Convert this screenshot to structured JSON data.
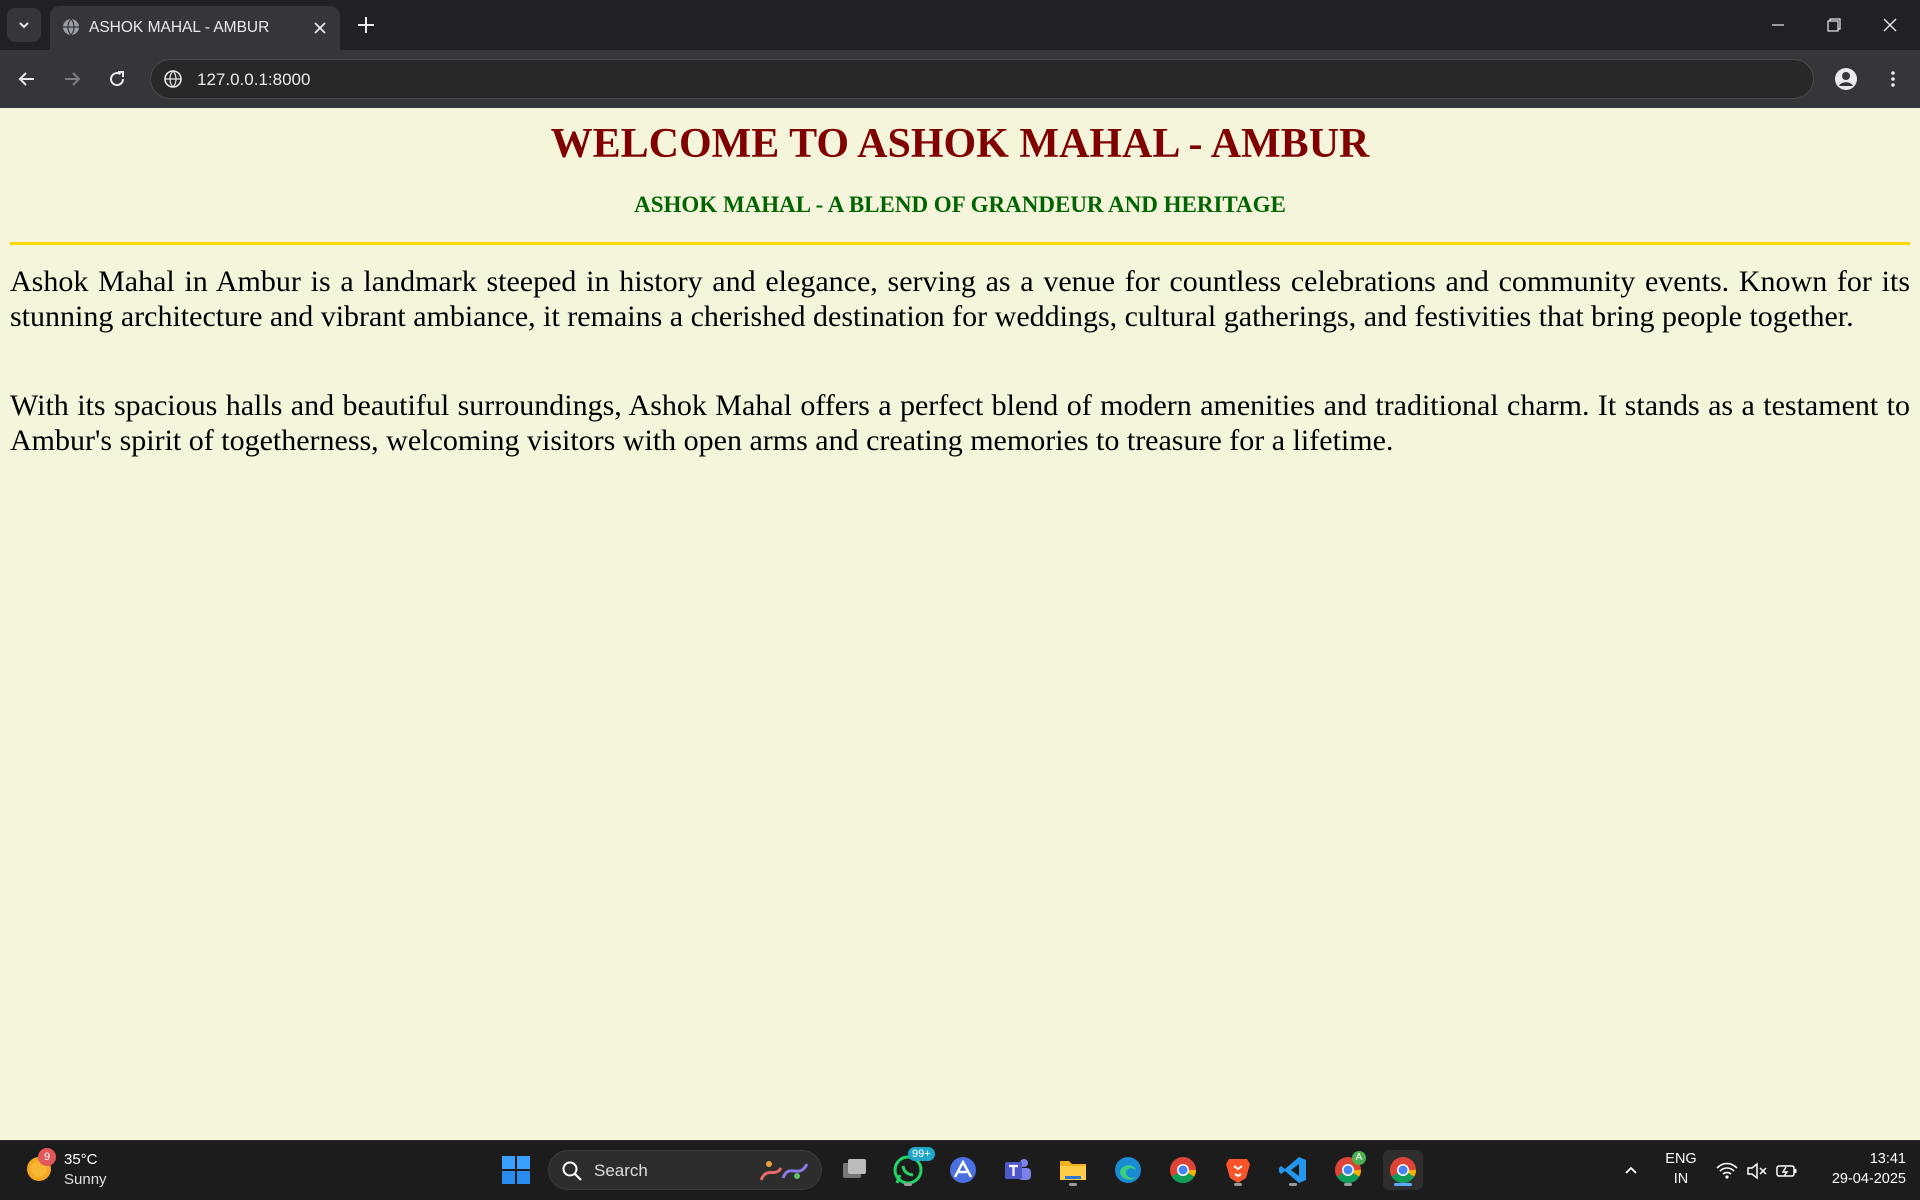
{
  "browser": {
    "tab_title": "ASHOK MAHAL - AMBUR",
    "url": "127.0.0.1:8000"
  },
  "page": {
    "heading": "WELCOME TO ASHOK MAHAL - AMBUR",
    "subheading": "ASHOK MAHAL - A BLEND OF GRANDEUR AND HERITAGE",
    "paragraphs": [
      "Ashok Mahal in Ambur is a landmark steeped in history and elegance, serving as a venue for countless celebrations and community events. Known for its stunning architecture and vibrant ambiance, it remains a cherished destination for weddings, cultural gatherings, and festivities that bring people together.",
      "With its spacious halls and beautiful surroundings, Ashok Mahal offers a perfect blend of modern amenities and traditional charm. It stands as a testament to Ambur's spirit of togetherness, welcoming visitors with open arms and creating memories to treasure for a lifetime."
    ],
    "colors": {
      "background": "#f5f5dc",
      "heading": "#800000",
      "subheading": "#006400",
      "rule": "#ffd700"
    }
  },
  "taskbar": {
    "weather_badge": "9",
    "weather_temp": "35°C",
    "weather_condition": "Sunny",
    "search_label": "Search",
    "whatsapp_badge": "99+",
    "chrome_profile_badge": "A",
    "language_line1": "ENG",
    "language_line2": "IN",
    "time": "13:41",
    "date": "29-04-2025",
    "apps": [
      "start-icon",
      "task-view-icon",
      "whatsapp-icon",
      "arc-app-icon",
      "teams-icon",
      "file-explorer-icon",
      "edge-icon",
      "chrome-icon",
      "brave-icon",
      "vscode-icon",
      "chrome-profile-icon",
      "chrome-active-icon"
    ]
  }
}
